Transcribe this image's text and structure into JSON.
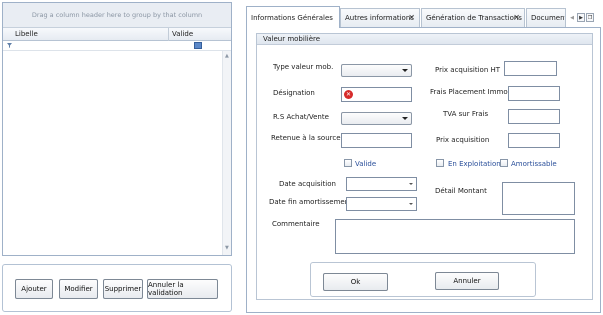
{
  "grid": {
    "group_hint": "Drag a column header here to group by that column",
    "columns": [
      "Libelle",
      "Valide"
    ]
  },
  "left_buttons": {
    "ajouter": "Ajouter",
    "modifier": "Modifier",
    "supprimer": "Supprimer",
    "annuler_validation": "Annuler la validation"
  },
  "tabs": [
    {
      "label": "Informations Générales",
      "active": true
    },
    {
      "label": "Autres informations"
    },
    {
      "label": "Génération de Transactions"
    },
    {
      "label": "Document"
    }
  ],
  "section_title": "Valeur mobilière",
  "form": {
    "type_valeur": "Type valeur mob.",
    "designation": "Désignation",
    "rs_achat": "R.S Achat/Vente",
    "retenue": "Retenue à la source",
    "prix_acq_ht": "Prix acquisition HT",
    "frais_placement": "Frais Placement Immo.",
    "tva_frais": "TVA sur Frais",
    "prix_acq": "Prix acquisition",
    "valide": "Valide",
    "en_exploitation": "En Exploitation",
    "amortissable": "Amortissable",
    "date_acq": "Date acquisition",
    "date_fin_amort": "Date fin amortissement",
    "detail_montant": "Détail Montant",
    "commentaire": "Commentaire"
  },
  "buttons": {
    "ok": "Ok",
    "annuler": "Annuler"
  },
  "colors": {
    "border": "#9fb1c8",
    "error": "#d62b2b"
  }
}
